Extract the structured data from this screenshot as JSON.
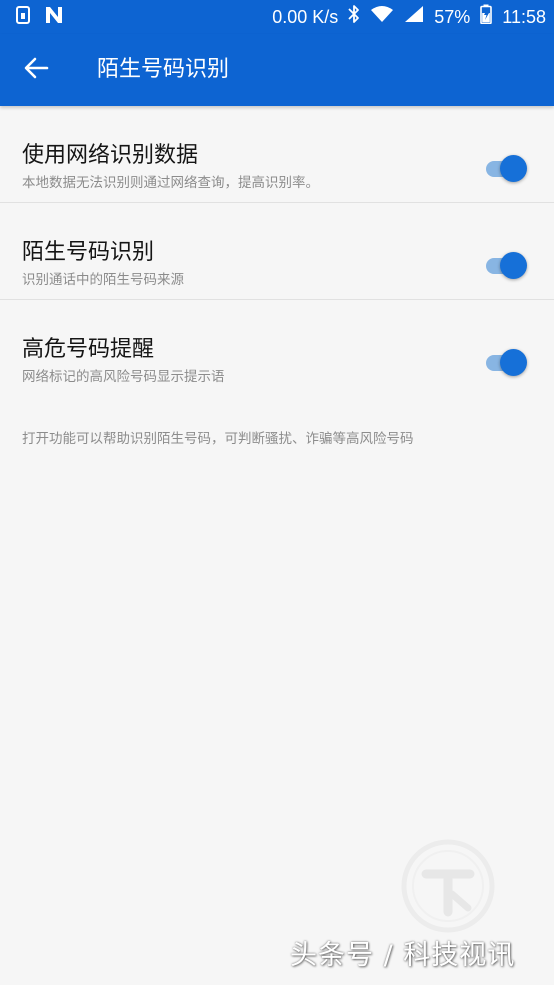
{
  "status_bar": {
    "network_speed": "0.00 K/s",
    "battery": "57%",
    "time": "11:58",
    "icons": [
      "sim-card-icon",
      "n-logo-icon",
      "bluetooth-icon",
      "wifi-icon",
      "cell-signal-icon",
      "battery-icon"
    ]
  },
  "app_bar": {
    "title": "陌生号码识别",
    "back_icon": "arrow-back-icon"
  },
  "settings": [
    {
      "title": "使用网络识别数据",
      "subtitle": "本地数据无法识别则通过网络查询，提高识别率。",
      "enabled": true
    },
    {
      "title": "陌生号码识别",
      "subtitle": "识别通话中的陌生号码来源",
      "enabled": true
    },
    {
      "title": "高危号码提醒",
      "subtitle": "网络标记的高风险号码显示提示语",
      "enabled": true
    }
  ],
  "footer_note": "打开功能可以帮助识别陌生号码，可判断骚扰、诈骗等高风险号码",
  "watermark": {
    "text": "头条号 / 科技视讯"
  },
  "colors": {
    "primary": "#0d64d2",
    "accent": "#1670d8",
    "track": "#88b5e3",
    "background": "#f6f6f6"
  }
}
